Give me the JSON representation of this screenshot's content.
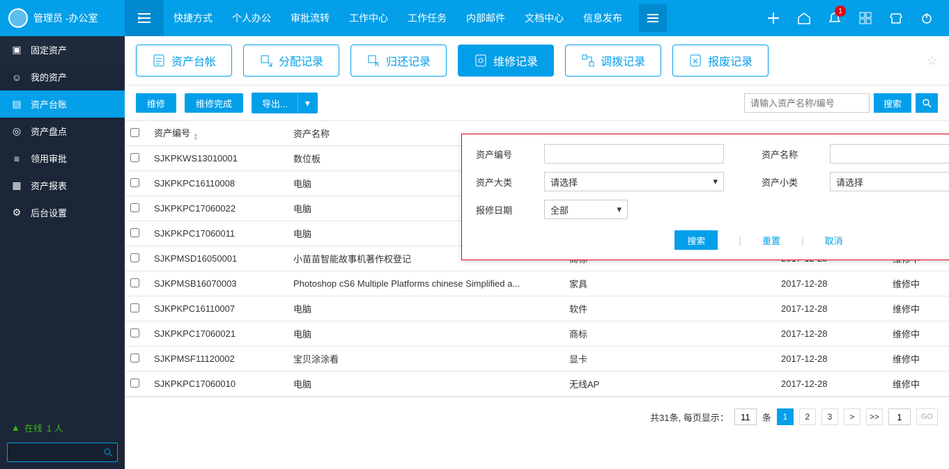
{
  "header": {
    "user_label": "管理员 -办公室",
    "menu": [
      "快捷方式",
      "个人办公",
      "审批流转",
      "工作中心",
      "工作任务",
      "内部邮件",
      "文档中心",
      "信息发布"
    ],
    "badge_count": "1"
  },
  "sidebar": {
    "items": [
      {
        "label": "固定资产",
        "icon": "folder-icon",
        "level": 1,
        "active": false
      },
      {
        "label": "我的资产",
        "icon": "user-icon",
        "level": 2,
        "active": false
      },
      {
        "label": "资产台账",
        "icon": "ledger-icon",
        "level": 2,
        "active": true
      },
      {
        "label": "资产盘点",
        "icon": "inventory-icon",
        "level": 2,
        "active": false
      },
      {
        "label": "领用审批",
        "icon": "approve-icon",
        "level": 2,
        "active": false
      },
      {
        "label": "资产报表",
        "icon": "report-icon",
        "level": 2,
        "active": false
      },
      {
        "label": "后台设置",
        "icon": "settings-icon",
        "level": 2,
        "active": false
      }
    ],
    "online_label": "在线",
    "online_count": "1 人"
  },
  "tabs": [
    {
      "label": "资产台帐",
      "active": false
    },
    {
      "label": "分配记录",
      "active": false
    },
    {
      "label": "归还记录",
      "active": false
    },
    {
      "label": "维修记录",
      "active": true
    },
    {
      "label": "调拨记录",
      "active": false
    },
    {
      "label": "报废记录",
      "active": false
    }
  ],
  "toolbar": {
    "repair": "维修",
    "repair_done": "维修完成",
    "export": "导出...",
    "search_placeholder": "请输入资产名称/编号",
    "search_btn": "搜索"
  },
  "filter": {
    "code_label": "资产编号",
    "name_label": "资产名称",
    "cat_label": "资产大类",
    "subcat_label": "资产小类",
    "date_label": "报修日期",
    "select_placeholder": "请选择",
    "date_placeholder": "全部",
    "search": "搜索",
    "reset": "重置",
    "cancel": "取消"
  },
  "table": {
    "headers": {
      "code": "资产编号",
      "name": "资产名称"
    },
    "rows": [
      {
        "code": "SJKPKWS13010001",
        "name": "数位板",
        "cat": "",
        "date": "",
        "status": ""
      },
      {
        "code": "SJKPKPC16110008",
        "name": "电脑",
        "cat": "",
        "date": "",
        "status": ""
      },
      {
        "code": "SJKPKPC17060022",
        "name": "电脑",
        "cat": "",
        "date": "",
        "status": ""
      },
      {
        "code": "SJKPKPC17060011",
        "name": "电脑",
        "cat": "",
        "date": "",
        "status": ""
      },
      {
        "code": "SJKPMSD16050001",
        "name": "小苗苗智能故事机著作权登记",
        "cat": "商标",
        "date": "2017-12-28",
        "status": "维修中"
      },
      {
        "code": "SJKPMSB16070003",
        "name": "Photoshop cS6 Multiple Platforms chinese Simplified a...",
        "cat": "家具",
        "date": "2017-12-28",
        "status": "维修中"
      },
      {
        "code": "SJKPKPC16110007",
        "name": "电脑",
        "cat": "软件",
        "date": "2017-12-28",
        "status": "维修中"
      },
      {
        "code": "SJKPKPC17060021",
        "name": "电脑",
        "cat": "商标",
        "date": "2017-12-28",
        "status": "维修中"
      },
      {
        "code": "SJKPMSF11120002",
        "name": "宝贝涂涂看",
        "cat": "显卡",
        "date": "2017-12-28",
        "status": "维修中"
      },
      {
        "code": "SJKPKPC17060010",
        "name": "电脑",
        "cat": "无线AP",
        "date": "2017-12-28",
        "status": "维修中"
      }
    ]
  },
  "pager": {
    "total_label": "共31条, 每页显示：",
    "per_page": "11",
    "unit": "条",
    "pages": [
      "1",
      "2",
      "3"
    ],
    "next": ">",
    "last": ">>",
    "goto_value": "1",
    "go_label": "GO"
  }
}
